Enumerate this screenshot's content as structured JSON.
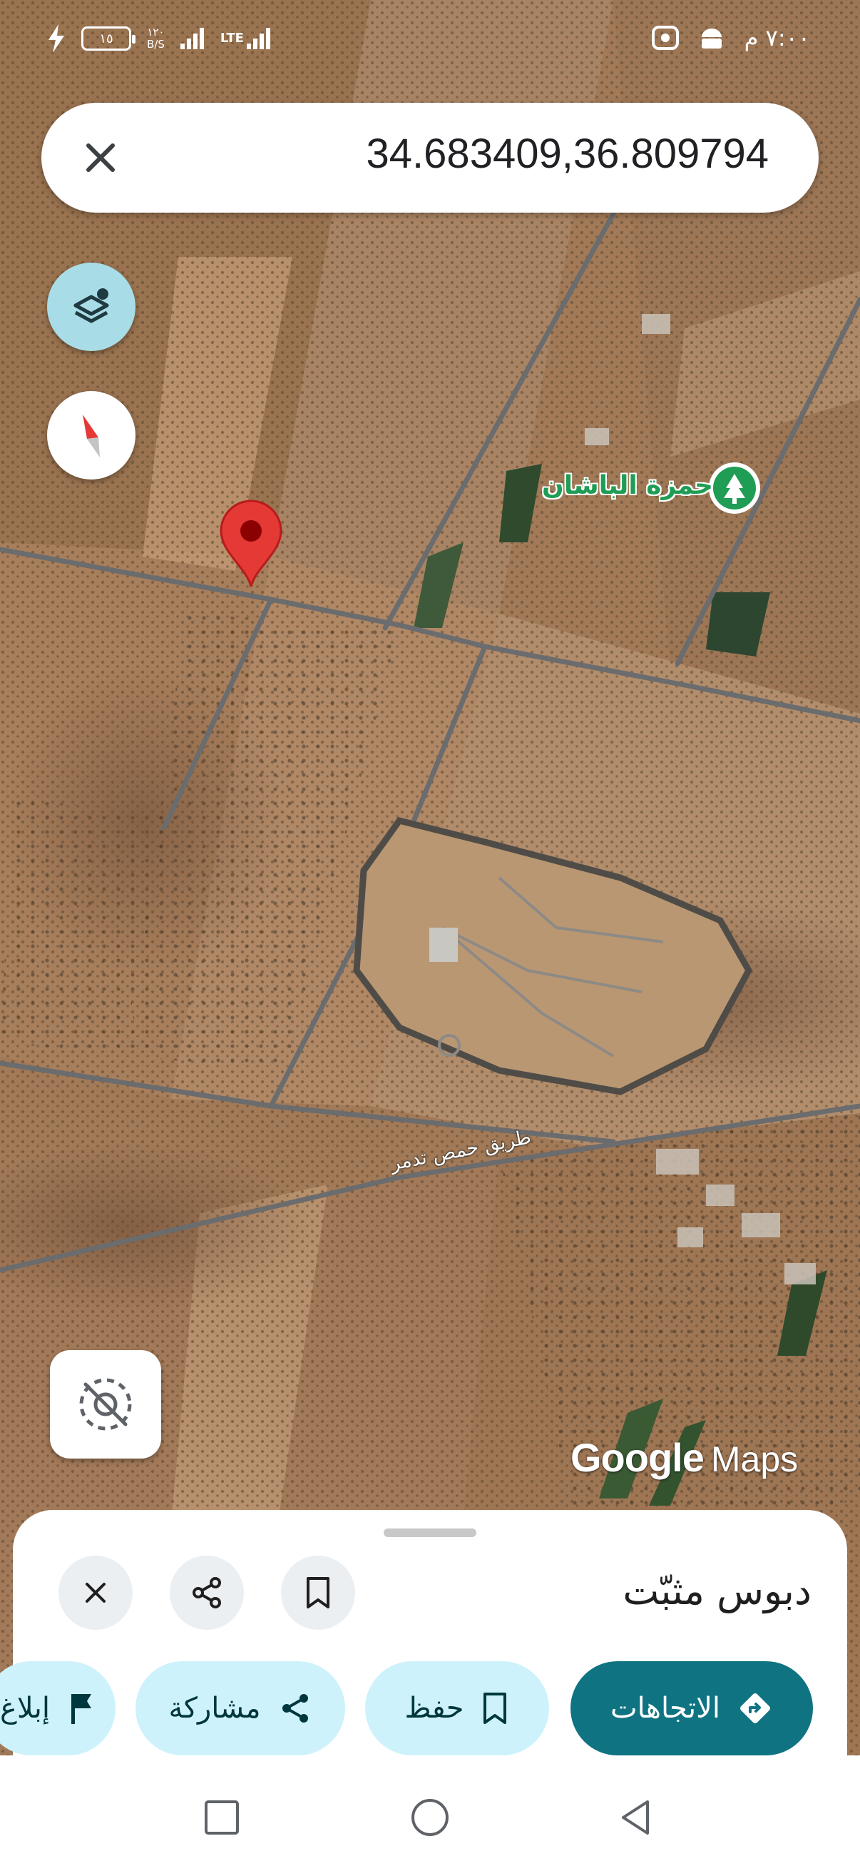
{
  "status_bar": {
    "time": "٧:٠٠ م",
    "battery_level": "١٥",
    "network_speed": "١٢٠",
    "network_speed_unit": "B/S",
    "network_type": "LTE"
  },
  "search": {
    "value": "34.683409,36.809794"
  },
  "map": {
    "place_label": "حمزة الباشان",
    "road_label": "طريق حمص تدمر",
    "logo_google": "Google",
    "logo_maps": "Maps",
    "pin_color": "#e53935",
    "place_icon_color": "#1f9d55",
    "layers_button_color": "#a8dde8"
  },
  "sheet": {
    "title": "دبوس مثبّت",
    "chips": {
      "directions": "الاتجاهات",
      "save": "حفظ",
      "share": "مشاركة",
      "report": "إبلاغ"
    },
    "accent_color": "#0f7382",
    "chip_color": "#cdf2fb"
  }
}
